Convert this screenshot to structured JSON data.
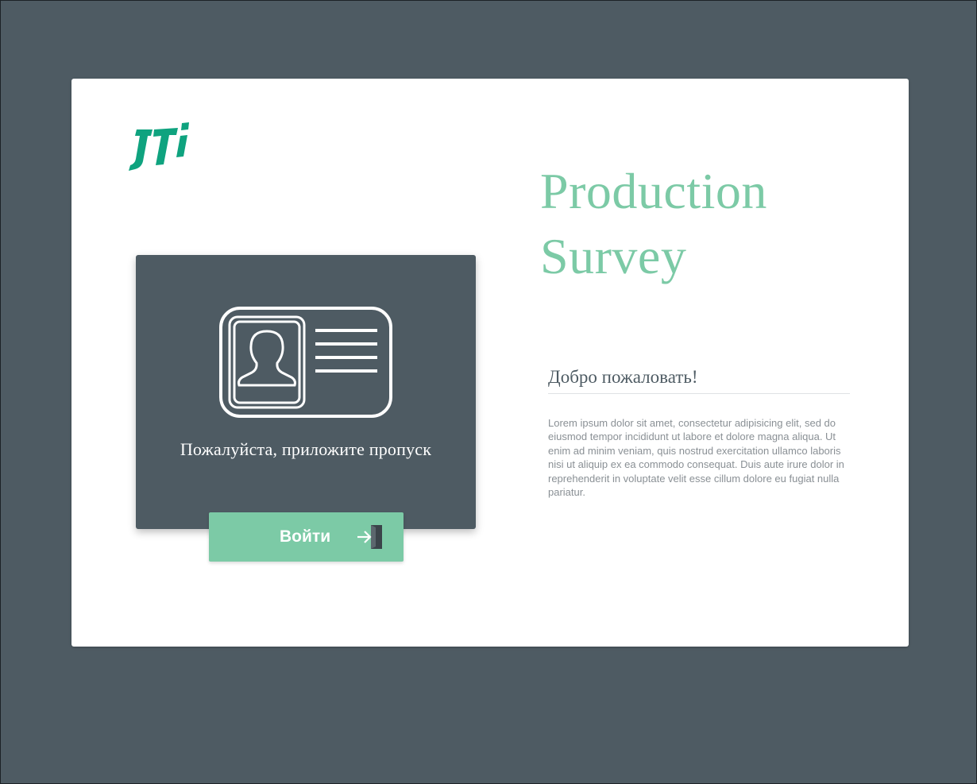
{
  "brand": {
    "logo_text": "JTi",
    "accent_color": "#7ccaa6",
    "logo_color": "#0fa37f",
    "panel_color": "#4e5b63"
  },
  "hero": {
    "title_line1": "Production",
    "title_line2": "Survey"
  },
  "badge": {
    "icon": "id-card-icon",
    "prompt": "Пожалуйста, приложите пропуск"
  },
  "login": {
    "label": "Войти",
    "icon": "door-enter-icon"
  },
  "welcome": {
    "heading": "Добро пожаловать!",
    "text": "Lorem ipsum dolor sit amet, consectetur adipisicing elit, sed do eiusmod tempor incididunt ut labore et dolore magna aliqua. Ut enim ad minim veniam, quis nostrud exercitation ullamco laboris nisi ut aliquip ex ea commodo consequat. Duis aute irure dolor in reprehenderit in voluptate velit esse cillum dolore eu fugiat nulla pariatur."
  }
}
